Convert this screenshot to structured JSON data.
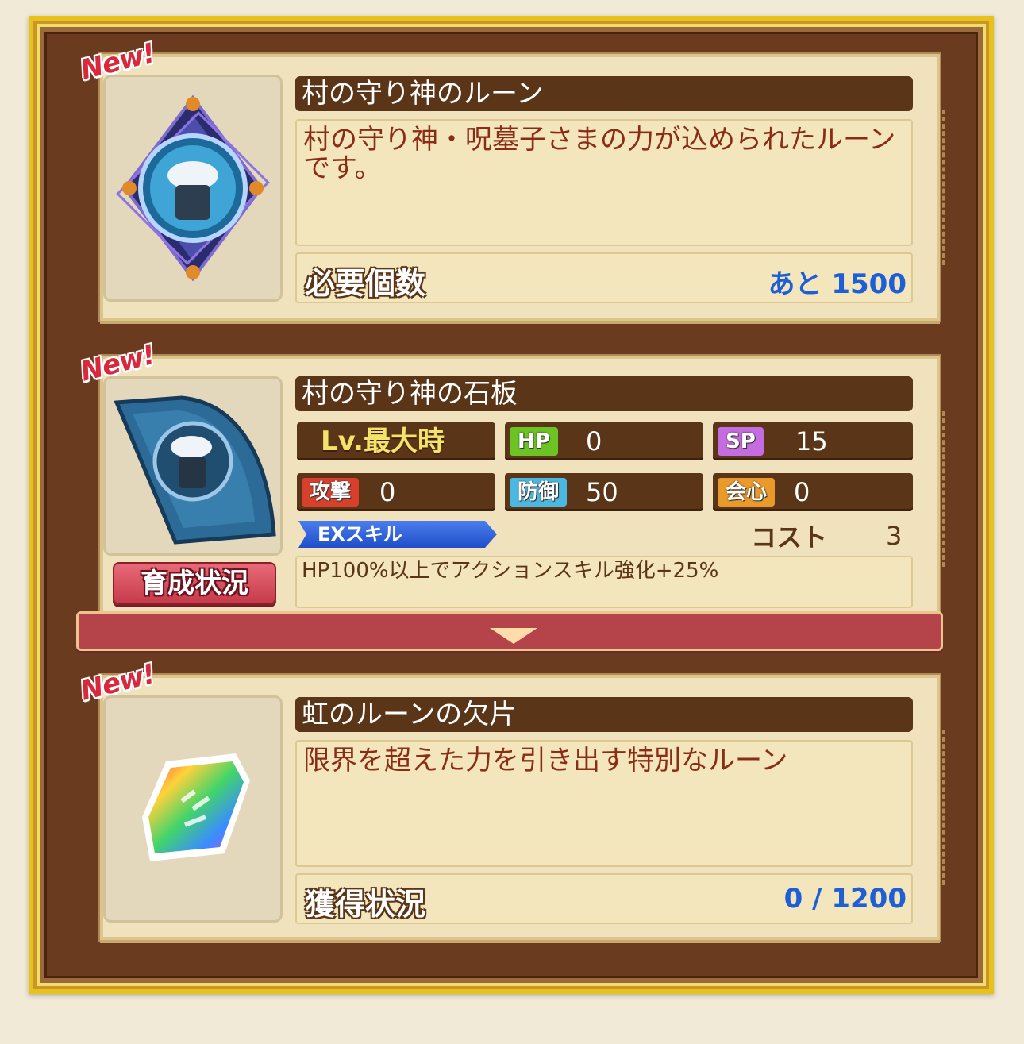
{
  "items": [
    {
      "badge": "New!",
      "title": "村の守り神のルーン",
      "description": "村の守り神・呪墓子さまの力が込められたルーンです。",
      "footer_label": "必要個数",
      "footer_value": "あと 1500",
      "icon": "rune-icon"
    },
    {
      "badge": "New!",
      "title": "村の守り神の石板",
      "level_label": "Lv.最大時",
      "stats": {
        "hp_label": "HP",
        "hp": "0",
        "sp_label": "SP",
        "sp": "15",
        "atk_label": "攻撃",
        "atk": "0",
        "def_label": "防御",
        "def": "50",
        "crit_label": "会心",
        "crit": "0"
      },
      "ex_skill_label": "EXスキル",
      "cost_label": "コスト",
      "cost_value": "3",
      "skill_text": "HP100%以上でアクションスキル強化+25%",
      "growth_button": "育成状況",
      "icon": "stone-tablet-icon"
    },
    {
      "badge": "New!",
      "title": "虹のルーンの欠片",
      "description": "限界を超えた力を引き出す特別なルーン",
      "footer_label": "獲得状況",
      "footer_value": "0 / 1200",
      "icon": "rainbow-rune-fragment-icon"
    }
  ],
  "colors": {
    "title_bar": "#5b3517",
    "desc_text": "#8a2d16",
    "value_blue": "#1f5fd6",
    "hp_tag": "#6cc424",
    "sp_tag": "#c56ce0",
    "atk_tag": "#d8402c",
    "def_tag": "#4ab8e0",
    "crit_tag": "#e89a2a"
  },
  "expand_icon": "chevron-down-icon"
}
